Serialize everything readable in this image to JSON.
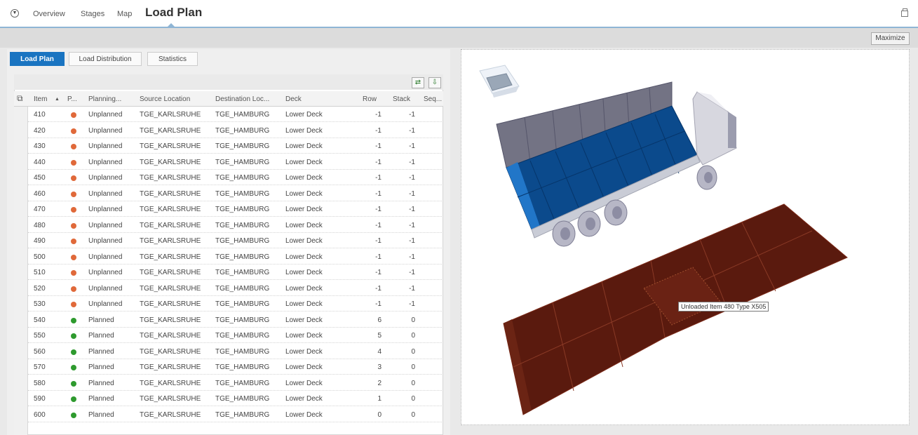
{
  "nav": {
    "items": [
      "Overview",
      "Stages",
      "Map"
    ],
    "active": "Load Plan"
  },
  "toolbar": {
    "maximize": "Maximize"
  },
  "tabs": [
    "Load Plan",
    "Load Distribution",
    "Statistics"
  ],
  "table": {
    "headers": {
      "item": "Item",
      "sort": "▲",
      "status": "P...",
      "planning": "Planning...",
      "source": "Source Location",
      "dest": "Destination Loc...",
      "deck": "Deck",
      "row": "Row",
      "stack": "Stack",
      "seq": "Seq..."
    },
    "rows": [
      {
        "item": "410",
        "status": "unplanned",
        "planning": "Unplanned",
        "source": "TGE_KARLSRUHE",
        "dest": "TGE_HAMBURG",
        "deck": "Lower Deck",
        "row": "-1",
        "stack": "-1"
      },
      {
        "item": "420",
        "status": "unplanned",
        "planning": "Unplanned",
        "source": "TGE_KARLSRUHE",
        "dest": "TGE_HAMBURG",
        "deck": "Lower Deck",
        "row": "-1",
        "stack": "-1"
      },
      {
        "item": "430",
        "status": "unplanned",
        "planning": "Unplanned",
        "source": "TGE_KARLSRUHE",
        "dest": "TGE_HAMBURG",
        "deck": "Lower Deck",
        "row": "-1",
        "stack": "-1"
      },
      {
        "item": "440",
        "status": "unplanned",
        "planning": "Unplanned",
        "source": "TGE_KARLSRUHE",
        "dest": "TGE_HAMBURG",
        "deck": "Lower Deck",
        "row": "-1",
        "stack": "-1"
      },
      {
        "item": "450",
        "status": "unplanned",
        "planning": "Unplanned",
        "source": "TGE_KARLSRUHE",
        "dest": "TGE_HAMBURG",
        "deck": "Lower Deck",
        "row": "-1",
        "stack": "-1"
      },
      {
        "item": "460",
        "status": "unplanned",
        "planning": "Unplanned",
        "source": "TGE_KARLSRUHE",
        "dest": "TGE_HAMBURG",
        "deck": "Lower Deck",
        "row": "-1",
        "stack": "-1"
      },
      {
        "item": "470",
        "status": "unplanned",
        "planning": "Unplanned",
        "source": "TGE_KARLSRUHE",
        "dest": "TGE_HAMBURG",
        "deck": "Lower Deck",
        "row": "-1",
        "stack": "-1"
      },
      {
        "item": "480",
        "status": "unplanned",
        "planning": "Unplanned",
        "source": "TGE_KARLSRUHE",
        "dest": "TGE_HAMBURG",
        "deck": "Lower Deck",
        "row": "-1",
        "stack": "-1"
      },
      {
        "item": "490",
        "status": "unplanned",
        "planning": "Unplanned",
        "source": "TGE_KARLSRUHE",
        "dest": "TGE_HAMBURG",
        "deck": "Lower Deck",
        "row": "-1",
        "stack": "-1"
      },
      {
        "item": "500",
        "status": "unplanned",
        "planning": "Unplanned",
        "source": "TGE_KARLSRUHE",
        "dest": "TGE_HAMBURG",
        "deck": "Lower Deck",
        "row": "-1",
        "stack": "-1"
      },
      {
        "item": "510",
        "status": "unplanned",
        "planning": "Unplanned",
        "source": "TGE_KARLSRUHE",
        "dest": "TGE_HAMBURG",
        "deck": "Lower Deck",
        "row": "-1",
        "stack": "-1"
      },
      {
        "item": "520",
        "status": "unplanned",
        "planning": "Unplanned",
        "source": "TGE_KARLSRUHE",
        "dest": "TGE_HAMBURG",
        "deck": "Lower Deck",
        "row": "-1",
        "stack": "-1"
      },
      {
        "item": "530",
        "status": "unplanned",
        "planning": "Unplanned",
        "source": "TGE_KARLSRUHE",
        "dest": "TGE_HAMBURG",
        "deck": "Lower Deck",
        "row": "-1",
        "stack": "-1"
      },
      {
        "item": "540",
        "status": "planned",
        "planning": "Planned",
        "source": "TGE_KARLSRUHE",
        "dest": "TGE_HAMBURG",
        "deck": "Lower Deck",
        "row": "6",
        "stack": "0"
      },
      {
        "item": "550",
        "status": "planned",
        "planning": "Planned",
        "source": "TGE_KARLSRUHE",
        "dest": "TGE_HAMBURG",
        "deck": "Lower Deck",
        "row": "5",
        "stack": "0"
      },
      {
        "item": "560",
        "status": "planned",
        "planning": "Planned",
        "source": "TGE_KARLSRUHE",
        "dest": "TGE_HAMBURG",
        "deck": "Lower Deck",
        "row": "4",
        "stack": "0"
      },
      {
        "item": "570",
        "status": "planned",
        "planning": "Planned",
        "source": "TGE_KARLSRUHE",
        "dest": "TGE_HAMBURG",
        "deck": "Lower Deck",
        "row": "3",
        "stack": "0"
      },
      {
        "item": "580",
        "status": "planned",
        "planning": "Planned",
        "source": "TGE_KARLSRUHE",
        "dest": "TGE_HAMBURG",
        "deck": "Lower Deck",
        "row": "2",
        "stack": "0"
      },
      {
        "item": "590",
        "status": "planned",
        "planning": "Planned",
        "source": "TGE_KARLSRUHE",
        "dest": "TGE_HAMBURG",
        "deck": "Lower Deck",
        "row": "1",
        "stack": "0"
      },
      {
        "item": "600",
        "status": "planned",
        "planning": "Planned",
        "source": "TGE_KARLSRUHE",
        "dest": "TGE_HAMBURG",
        "deck": "Lower Deck",
        "row": "0",
        "stack": "0"
      }
    ]
  },
  "colors": {
    "unplanned": "#e0693a",
    "planned": "#2e9a2e",
    "accent": "#1a74c1",
    "load_blue": "#0b4a8c",
    "unloaded_brown": "#5a1a0e"
  },
  "viewer": {
    "tooltip": "Unloaded Item 480 Type X505"
  }
}
